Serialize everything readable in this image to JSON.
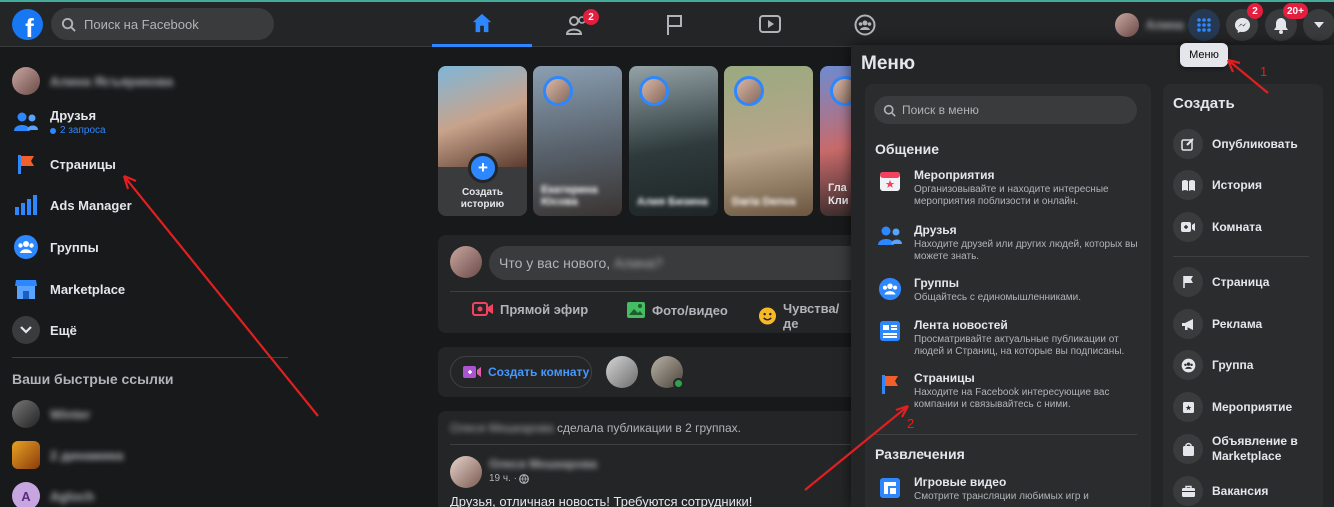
{
  "topbar": {
    "logo": "f",
    "search_placeholder": "Поиск на Facebook",
    "tabs": [
      {
        "icon": "home-icon",
        "active": true,
        "badge": ""
      },
      {
        "icon": "friends-icon",
        "active": false,
        "badge": "2"
      },
      {
        "icon": "flag-icon",
        "active": false,
        "badge": ""
      },
      {
        "icon": "watch-icon",
        "active": false,
        "badge": ""
      },
      {
        "icon": "groups-icon",
        "active": false,
        "badge": ""
      }
    ],
    "profile_name": "Алина",
    "messenger_badge": "2",
    "notifications_badge": "20+",
    "menu_tooltip": "Меню"
  },
  "sidebar": {
    "profile_name": "Алина Ясъярикова",
    "items": [
      {
        "label": "Друзья",
        "sub": "2 запроса",
        "icon": "friends-icon"
      },
      {
        "label": "Страницы",
        "icon": "pages-flag-icon"
      },
      {
        "label": "Ads Manager",
        "icon": "ads-chart-icon"
      },
      {
        "label": "Группы",
        "icon": "groups-icon"
      },
      {
        "label": "Marketplace",
        "icon": "marketplace-icon"
      },
      {
        "label": "Ещё",
        "icon": "chevron-down-icon"
      }
    ],
    "shortcuts_title": "Ваши быстрые ссылки",
    "shortcuts": [
      "Winter",
      "2 динамика",
      "Agloch"
    ]
  },
  "feed": {
    "create_story": "Создать историю",
    "stories": [
      "Екатерина Юсова",
      "Алия Бизина",
      "Daria Denva",
      "Гла Кли"
    ],
    "composer_placeholder": "Что у вас нового,",
    "composer_name": "Алина?",
    "actions": [
      "Прямой эфир",
      "Фото/видео",
      "Чувства/де"
    ],
    "create_room": "Создать комнату",
    "post_header_name": "Олеся Мешкарова",
    "post_header_text": "сделала публикации в 2 группах.",
    "post_author": "Олеся Мешкарова",
    "post_time": "19 ч. ·",
    "post_text": "Друзья, отличная новость! Требуются сотрудники!"
  },
  "menu": {
    "title": "Меню",
    "search_placeholder": "Поиск в меню",
    "section1": "Общение",
    "items": [
      {
        "title": "Мероприятия",
        "desc": "Организовывайте и находите интересные мероприятия поблизости и онлайн."
      },
      {
        "title": "Друзья",
        "desc": "Находите друзей или других людей, которых вы можете знать."
      },
      {
        "title": "Группы",
        "desc": "Общайтесь с единомышленниками."
      },
      {
        "title": "Лента новостей",
        "desc": "Просматривайте актуальные публикации от людей и Страниц, на которые вы подписаны."
      },
      {
        "title": "Страницы",
        "desc": "Находите на Facebook интересующие вас компании и связывайтесь с ними."
      }
    ],
    "section2": "Развлечения",
    "game_item": {
      "title": "Игровые видео",
      "desc": "Смотрите трансляции любимых игр и"
    },
    "create_title": "Создать",
    "create_items": [
      "Опубликовать",
      "История",
      "Комната",
      "Страница",
      "Реклама",
      "Группа",
      "Мероприятие",
      "Объявление в Marketplace",
      "Вакансия"
    ]
  },
  "annotations": {
    "one": "1",
    "two": "2"
  },
  "colors": {
    "accent": "#2d88ff",
    "badge": "#e41e3f",
    "arrow": "#e02020"
  }
}
